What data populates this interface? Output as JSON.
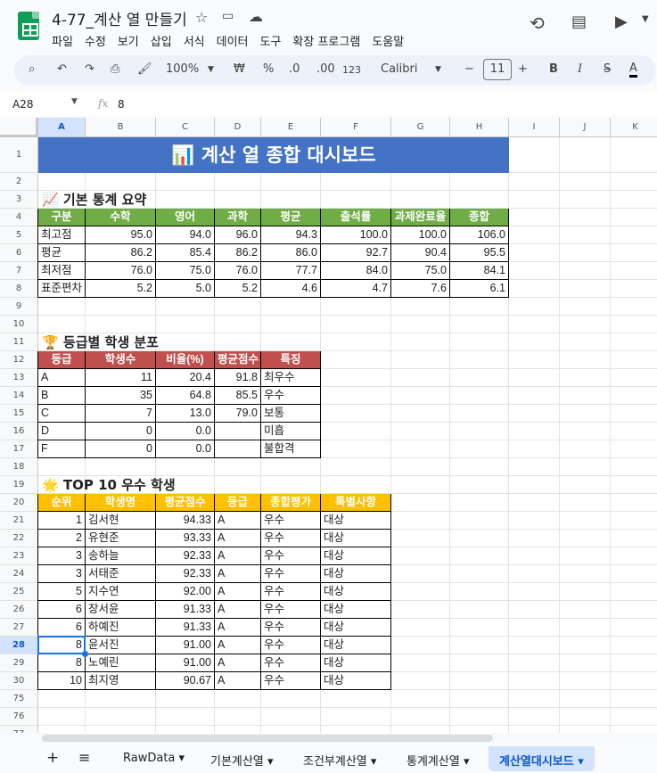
{
  "doc": {
    "title": "4-77_계산 열 만들기",
    "menu": [
      "파일",
      "수정",
      "보기",
      "삽입",
      "서식",
      "데이터",
      "도구",
      "확장 프로그램",
      "도움말"
    ]
  },
  "toolbar": {
    "zoom": "100%",
    "currency": "₩",
    "percent": "%",
    "dec_less": ".0",
    "dec_more": ".00",
    "format_123": "123",
    "font": "Calibri",
    "font_size": "11"
  },
  "formula_bar": {
    "cell_ref": "A28",
    "fx": "fx",
    "value": "8"
  },
  "columns": [
    "A",
    "B",
    "C",
    "D",
    "E",
    "F",
    "G",
    "H",
    "I",
    "J",
    "K"
  ],
  "row_numbers": [
    "1",
    "2",
    "3",
    "4",
    "5",
    "6",
    "7",
    "8",
    "9",
    "10",
    "11",
    "12",
    "13",
    "14",
    "15",
    "16",
    "17",
    "18",
    "19",
    "20",
    "21",
    "22",
    "23",
    "24",
    "25",
    "26",
    "27",
    "28",
    "29",
    "30",
    "75",
    "76",
    "77"
  ],
  "banner": {
    "title": "계산 열 종합 대시보드",
    "icon": "📊"
  },
  "section1": {
    "title": "기본 통계 요약",
    "icon": "📈",
    "headers": [
      "구분",
      "수학",
      "영어",
      "과학",
      "평균",
      "출석률",
      "과제완료율",
      "종합"
    ],
    "rows": [
      [
        "최고점",
        "95.0",
        "94.0",
        "96.0",
        "94.3",
        "100.0",
        "100.0",
        "106.0"
      ],
      [
        "평균",
        "86.2",
        "85.4",
        "86.2",
        "86.0",
        "92.7",
        "90.4",
        "95.5"
      ],
      [
        "최저점",
        "76.0",
        "75.0",
        "76.0",
        "77.7",
        "84.0",
        "75.0",
        "84.1"
      ],
      [
        "표준편차",
        "5.2",
        "5.0",
        "5.2",
        "4.6",
        "4.7",
        "7.6",
        "6.1"
      ]
    ]
  },
  "section2": {
    "title": "등급별 학생 분포",
    "icon": "🏆",
    "headers": [
      "등급",
      "학생수",
      "비율(%)",
      "평균점수",
      "특징"
    ],
    "rows": [
      [
        "A",
        "11",
        "20.4",
        "91.8",
        "최우수"
      ],
      [
        "B",
        "35",
        "64.8",
        "85.5",
        "우수"
      ],
      [
        "C",
        "7",
        "13.0",
        "79.0",
        "보통"
      ],
      [
        "D",
        "0",
        "0.0",
        "",
        "미흡"
      ],
      [
        "F",
        "0",
        "0.0",
        "",
        "불합격"
      ]
    ]
  },
  "section3": {
    "title": "TOP 10 우수 학생",
    "icon": "🌟",
    "headers": [
      "순위",
      "학생명",
      "평균점수",
      "등급",
      "종합평가",
      "특별사항"
    ],
    "rows": [
      [
        "1",
        "김서현",
        "94.33",
        "A",
        "우수",
        "대상"
      ],
      [
        "2",
        "유현준",
        "93.33",
        "A",
        "우수",
        "대상"
      ],
      [
        "3",
        "송하늘",
        "92.33",
        "A",
        "우수",
        "대상"
      ],
      [
        "3",
        "서태준",
        "92.33",
        "A",
        "우수",
        "대상"
      ],
      [
        "5",
        "지수연",
        "92.00",
        "A",
        "우수",
        "대상"
      ],
      [
        "6",
        "장서윤",
        "91.33",
        "A",
        "우수",
        "대상"
      ],
      [
        "6",
        "하예진",
        "91.33",
        "A",
        "우수",
        "대상"
      ],
      [
        "8",
        "윤서진",
        "91.00",
        "A",
        "우수",
        "대상"
      ],
      [
        "8",
        "노예린",
        "91.00",
        "A",
        "우수",
        "대상"
      ],
      [
        "10",
        "최지영",
        "90.67",
        "A",
        "우수",
        "대상"
      ]
    ]
  },
  "sheet_tabs": [
    "RawData",
    "기본계산열",
    "조건부계산열",
    "통계계산열",
    "계산열대시보드"
  ],
  "active_tab": "계산열대시보드",
  "colors": {
    "banner": "#4472c4",
    "green_header": "#70ad47",
    "red_header": "#c0504d",
    "gold_header": "#ffc000",
    "active_tab": "#d3e3fd"
  }
}
